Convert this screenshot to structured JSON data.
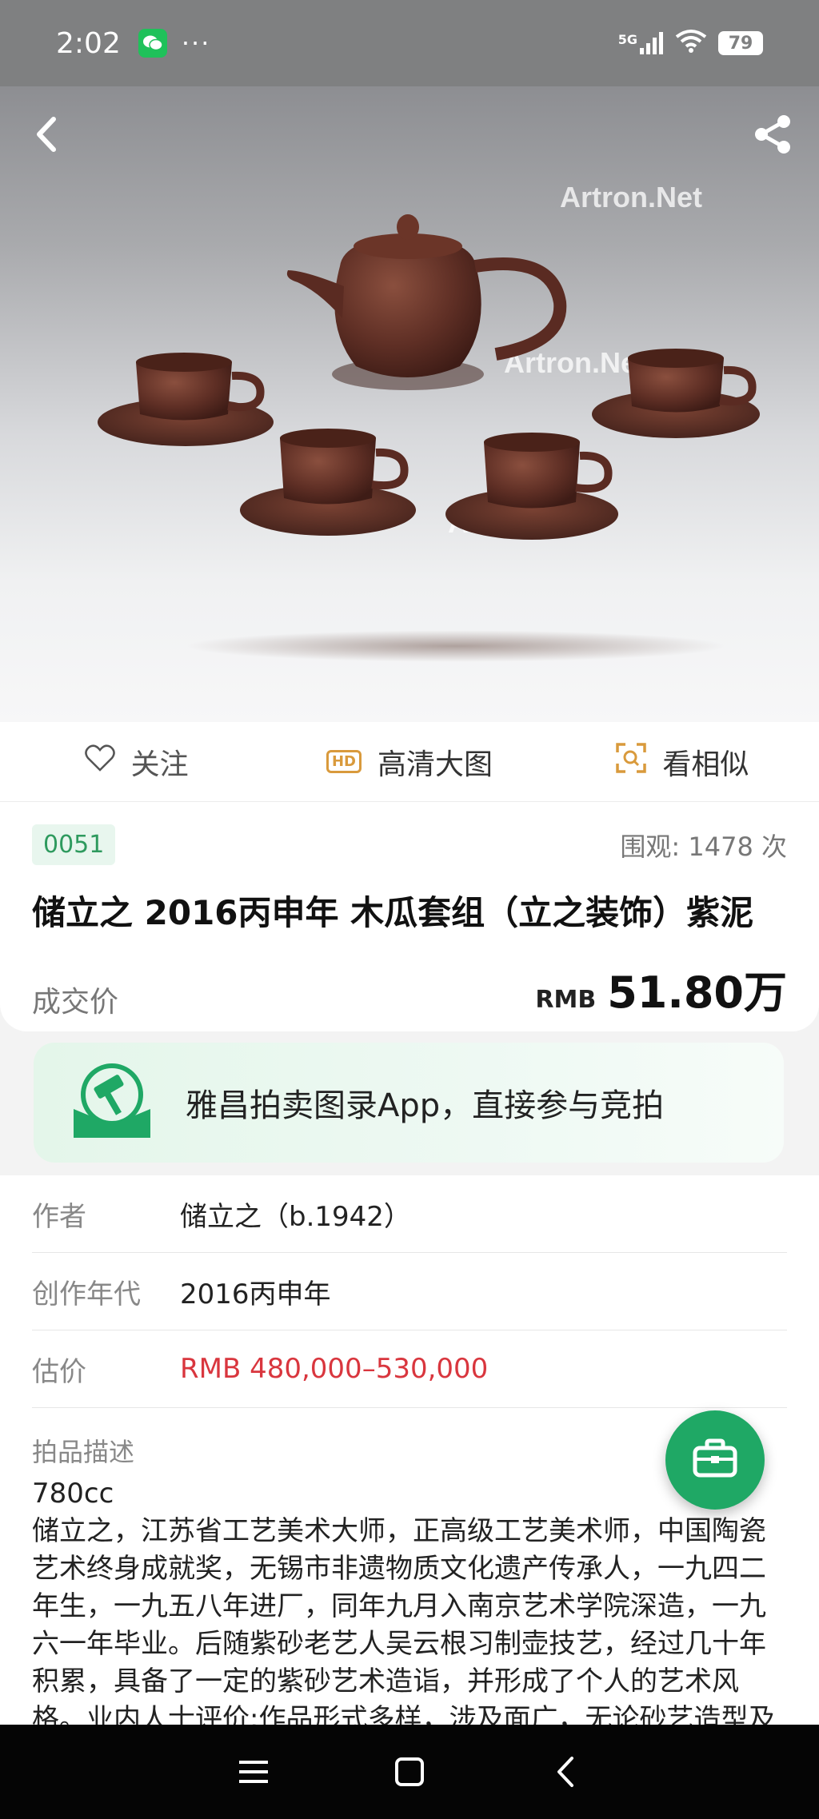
{
  "status_bar": {
    "time": "2:02",
    "dots": "···",
    "network": "5G",
    "battery": "79"
  },
  "hero": {
    "watermarks": [
      "Artron.Net",
      "Artron.Net",
      "Artron.Net"
    ]
  },
  "actions": {
    "follow": "关注",
    "hd_image": "高清大图",
    "similar": "看相似",
    "hd_badge": "HD"
  },
  "lot": {
    "number": "0051",
    "views": "围观:  1478  次",
    "title": "储立之 2016丙申年 木瓜套组（立之装饰）紫泥",
    "sold_label": "成交价",
    "currency": "RMB",
    "price": "51.80万"
  },
  "banner": {
    "text": "雅昌拍卖图录App，直接参与竞拍"
  },
  "details": {
    "author_label": "作者",
    "author_value": "储立之（b.1942）",
    "year_label": "创作年代",
    "year_value": "2016丙申年",
    "estimate_label": "估价",
    "estimate_value": "RMB  480,000–530,000",
    "desc_label": "拍品描述",
    "desc_text": "780cc\n储立之，江苏省工艺美术大师，正高级工艺美术师，中国陶瓷艺术终身成就奖，无锡市非遗物质文化遗产传承人，一九四二年生，一九五八年进厂，同年九月入南京艺术学院深造，一九六一年毕业。后随紫砂老艺人吴云根习制壶技艺，经过几十年积累，具备了一定的紫砂艺术造诣，并形成了个人的艺术风格。业内人士评价:作品形式多样，涉及面广，无论砂艺造型及"
  },
  "colors": {
    "accent_green": "#1fa865",
    "price_red": "#d9363e",
    "hd_orange": "#d99a3c"
  }
}
